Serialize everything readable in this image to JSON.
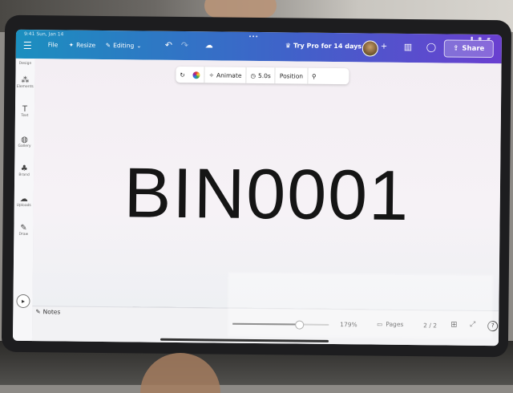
{
  "header": {
    "status_time": "9:41  Sun, Jan 14",
    "menu": {
      "file": "File",
      "resize": "Resize",
      "editing": "Editing"
    },
    "pro_promo": "Try Pro for 14 days",
    "share": "Share"
  },
  "sidebar": {
    "items": [
      {
        "label": "Design",
        "icon": "layout-icon"
      },
      {
        "label": "Elements",
        "icon": "shapes-icon"
      },
      {
        "label": "Text",
        "icon": "text-icon"
      },
      {
        "label": "Gallery",
        "icon": "gallery-icon"
      },
      {
        "label": "Brand",
        "icon": "brand-icon"
      },
      {
        "label": "Uploads",
        "icon": "upload-icon"
      },
      {
        "label": "Draw",
        "icon": "draw-icon"
      }
    ]
  },
  "toolbar": {
    "animate": "Animate",
    "duration": "5.0s",
    "position": "Position"
  },
  "canvas": {
    "text": "BIN0001"
  },
  "footer": {
    "notes": "Notes",
    "zoom": "179%",
    "zoom_level": 0.68,
    "pages": "Pages",
    "page_count": "2 / 2"
  },
  "colors": {
    "header_start": "#1b8fbf",
    "header_end": "#6a3fd0",
    "canvas_bg": "#f3eef3",
    "text": "#151515"
  }
}
